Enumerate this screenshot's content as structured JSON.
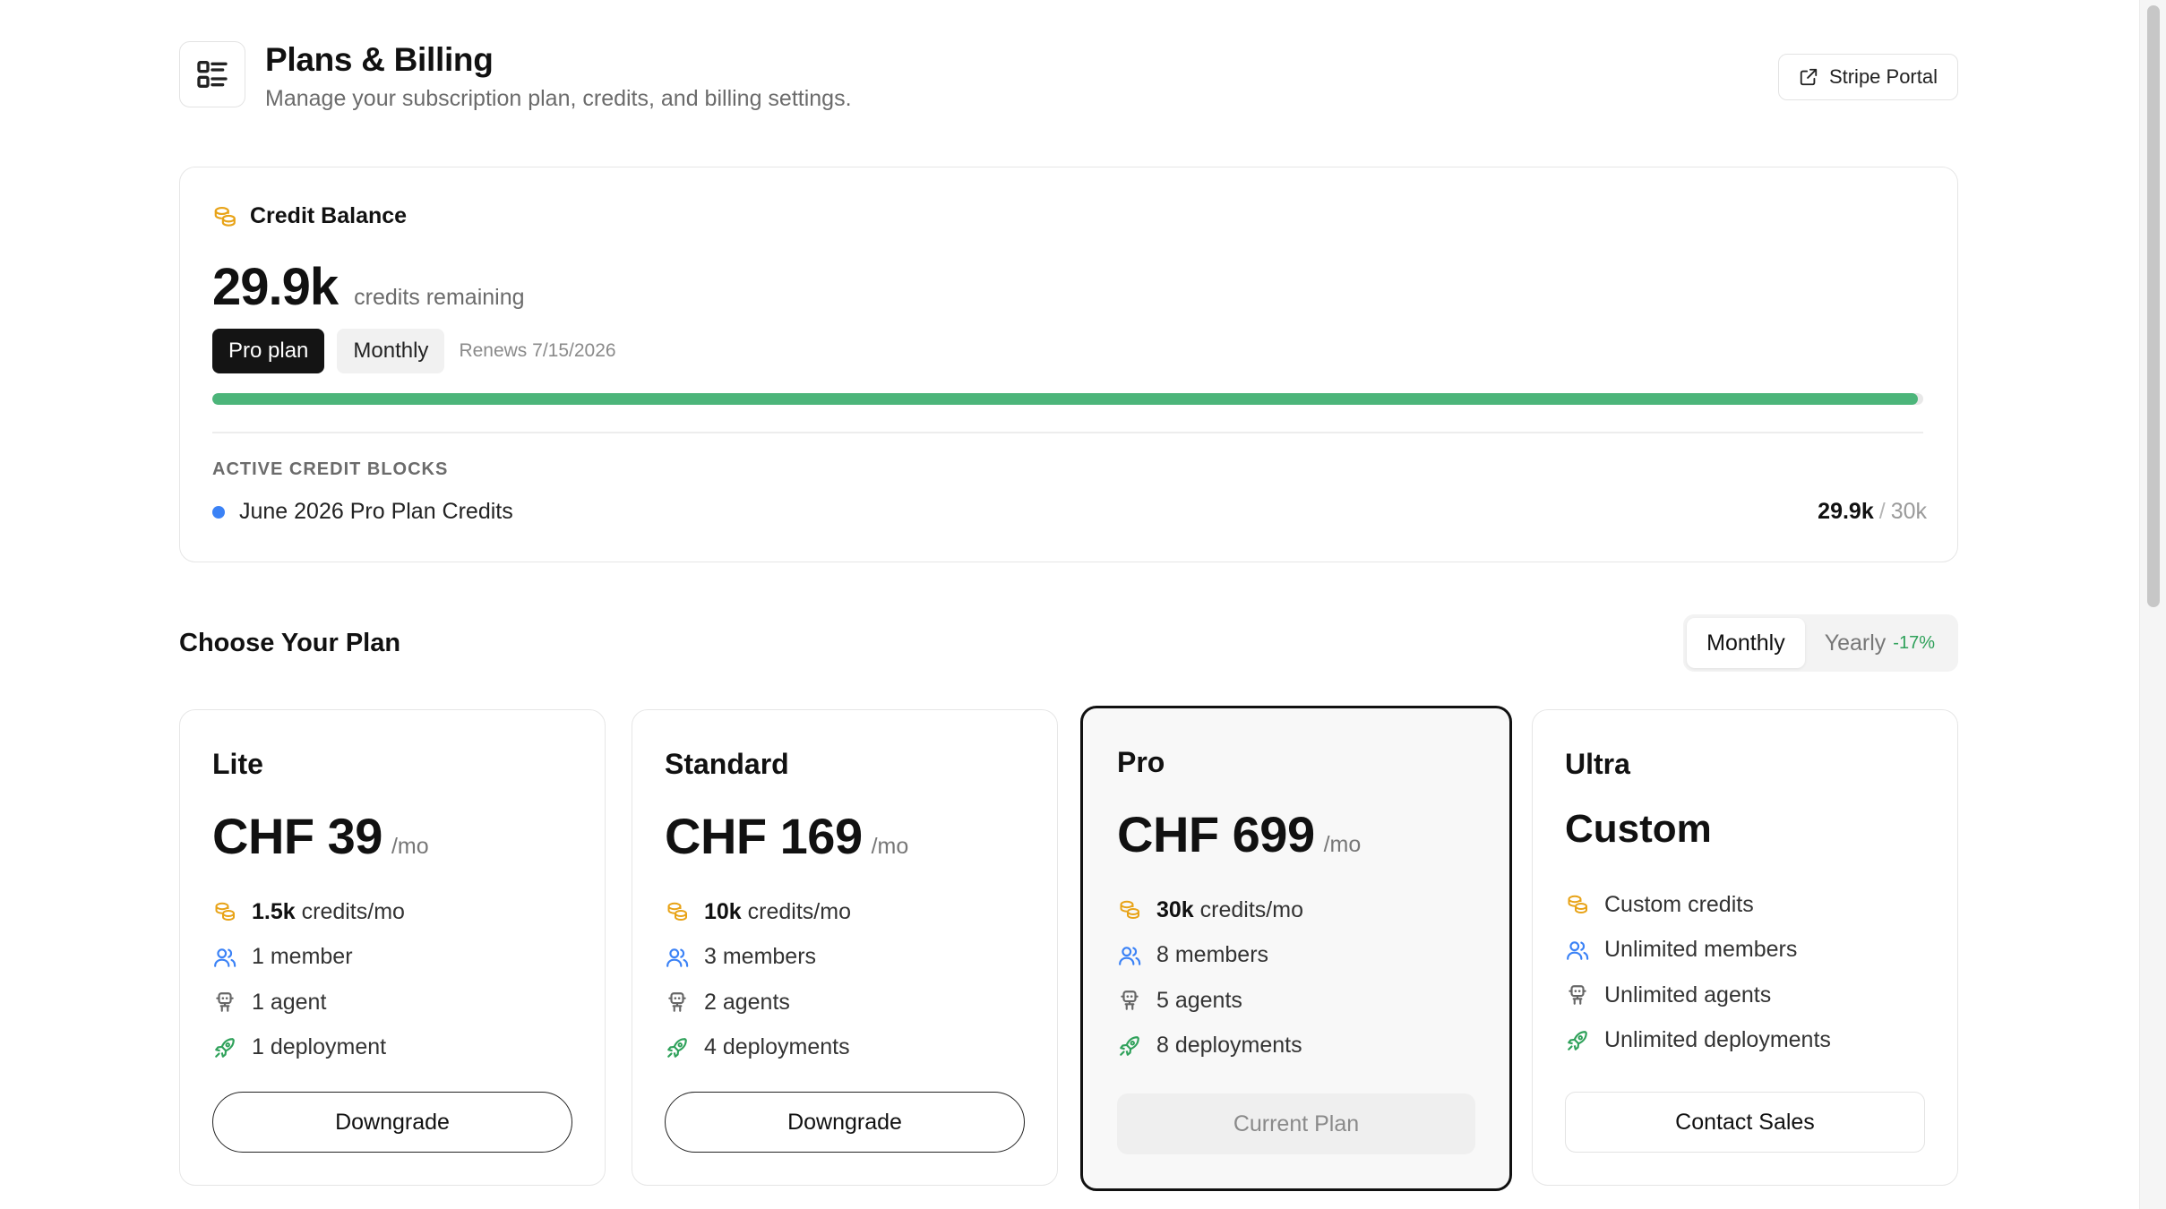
{
  "header": {
    "title": "Plans & Billing",
    "subtitle": "Manage your subscription plan, credits, and billing settings.",
    "stripe_button": "Stripe Portal"
  },
  "credit_balance": {
    "label": "Credit Balance",
    "amount": "29.9k",
    "amount_label": "credits remaining",
    "plan_tag": "Pro plan",
    "cycle_tag": "Monthly",
    "renews": "Renews 7/15/2026",
    "usage_fraction": 0.997,
    "active_blocks_title": "ACTIVE CREDIT BLOCKS",
    "blocks": [
      {
        "name": "June 2026 Pro Plan Credits",
        "used": "29.9k",
        "separator": "/",
        "total": "30k"
      }
    ]
  },
  "choose_plan": {
    "title": "Choose Your Plan",
    "toggle": {
      "monthly": "Monthly",
      "yearly": "Yearly",
      "yearly_discount": "-17%",
      "selected": "Monthly"
    }
  },
  "plans": [
    {
      "name": "Lite",
      "price": "CHF 39",
      "unit": "/mo",
      "credits_value": "1.5k",
      "credits_suffix": "credits/mo",
      "members": "1 member",
      "agents": "1 agent",
      "deployments": "1 deployment",
      "button": "Downgrade"
    },
    {
      "name": "Standard",
      "price": "CHF 169",
      "unit": "/mo",
      "credits_value": "10k",
      "credits_suffix": "credits/mo",
      "members": "3 members",
      "agents": "2 agents",
      "deployments": "4 deployments",
      "button": "Downgrade"
    },
    {
      "name": "Pro",
      "price": "CHF 699",
      "unit": "/mo",
      "credits_value": "30k",
      "credits_suffix": "credits/mo",
      "members": "8 members",
      "agents": "5 agents",
      "deployments": "8 deployments",
      "button": "Current Plan",
      "current": true
    },
    {
      "name": "Ultra",
      "price": "Custom",
      "credits": "Custom credits",
      "members": "Unlimited members",
      "agents": "Unlimited agents",
      "deployments": "Unlimited deployments",
      "button": "Contact Sales"
    }
  ],
  "colors": {
    "credit_icon": "#e8a317",
    "member_icon": "#3b82f6",
    "agent_icon": "#666666",
    "deploy_icon": "#2fa15a",
    "progress": "#4cb57a",
    "block_dot": "#3b82f6"
  },
  "icons": {
    "header": "list-icon",
    "stripe": "external-link-icon",
    "credits": "coins-icon",
    "members": "users-icon",
    "agents": "robot-icon",
    "deployments": "rocket-icon"
  }
}
